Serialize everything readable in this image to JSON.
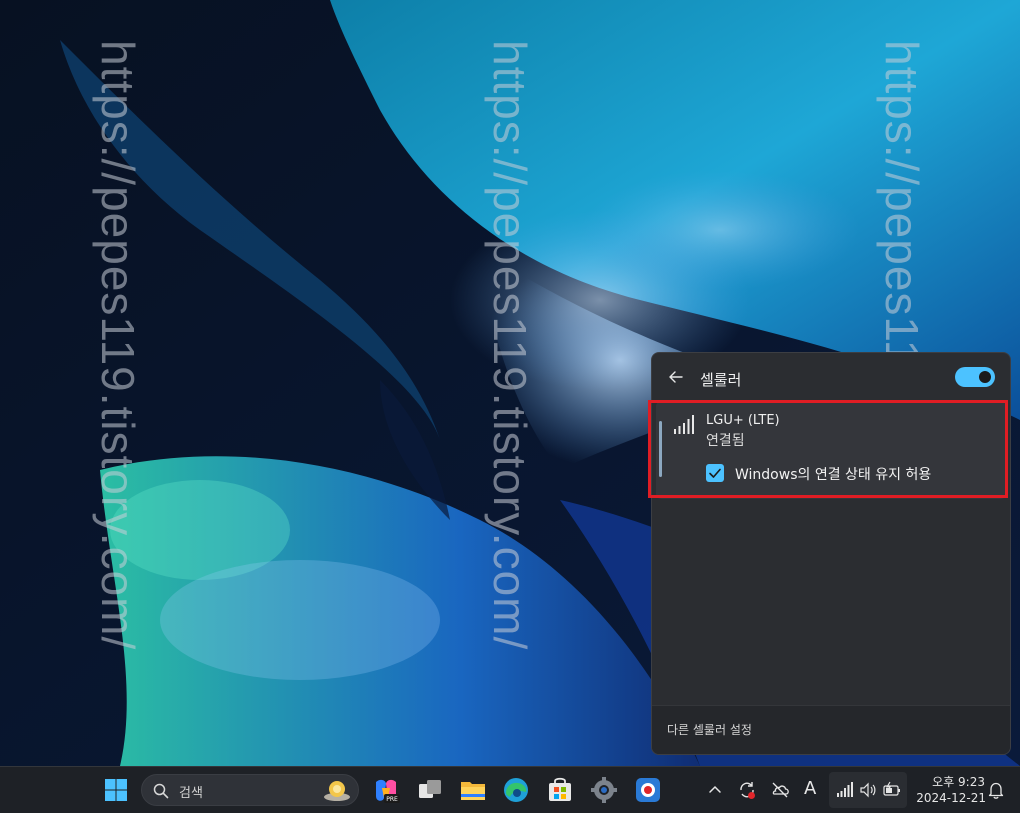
{
  "watermark": {
    "text": "https://pepes119.tistory.com/"
  },
  "flyout": {
    "title": "셀룰러",
    "toggle_state": "on",
    "network": {
      "name": "LGU+ (LTE)",
      "status": "연결됨",
      "checkbox_label": "Windows의 연결 상태 유지 허용",
      "checkbox_checked": true
    },
    "footer_link": "다른 셀룰러 설정"
  },
  "taskbar": {
    "search_placeholder": "검색",
    "pinned_apps": [
      "windows-start-icon",
      "copilot-pre-icon",
      "task-view-icon",
      "file-explorer-icon",
      "edge-icon",
      "microsoft-store-icon",
      "settings-icon",
      "screen-recorder-icon"
    ],
    "tray": {
      "ime_label": "A",
      "time": "오후 9:23",
      "date": "2024-12-21"
    }
  },
  "colors": {
    "accent": "#4cc2ff",
    "highlight": "#e01d24"
  }
}
